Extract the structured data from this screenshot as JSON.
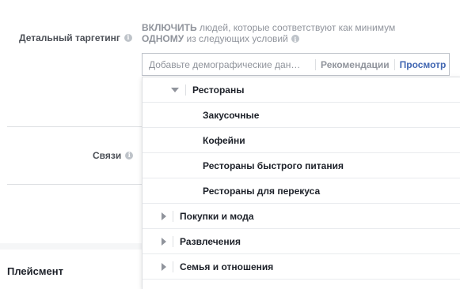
{
  "detailed_targeting": {
    "label": "Детальный таргетинг",
    "include_line1_bold": "ВКЛЮЧИТЬ",
    "include_line1_rest": " людей, которые соответствуют как минимум",
    "include_line2_bold": "ОДНОМУ",
    "include_line2_rest": " из следующих условий",
    "search_placeholder": "Добавьте демографические дан…",
    "recommendations_label": "Рекомендации",
    "browse_label": "Просмотр"
  },
  "connections": {
    "label": "Связи"
  },
  "placement": {
    "title": "Плейсмент"
  },
  "dropdown": {
    "expanded_category": "Рестораны",
    "subitems": [
      "Закусочные",
      "Кофейни",
      "Рестораны быстрого питания",
      "Рестораны для перекуса"
    ],
    "categories": [
      "Покупки и мода",
      "Развлечения",
      "Семья и отношения"
    ]
  },
  "colors": {
    "accent": "#4267b2",
    "muted_text": "#90949c",
    "border": "#dddfe2"
  }
}
